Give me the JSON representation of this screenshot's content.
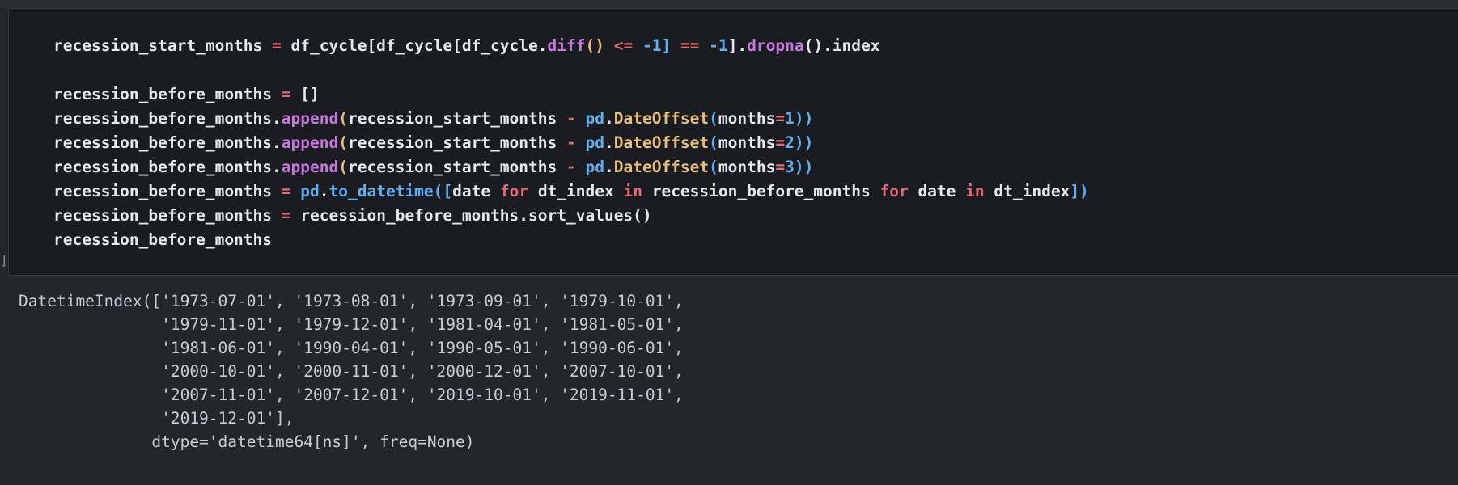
{
  "code_cell": {
    "marker": "]",
    "lines": [
      [
        {
          "t": "recession_start_months",
          "c": ""
        },
        {
          "t": " ",
          "c": ""
        },
        {
          "t": "=",
          "c": "tk-op"
        },
        {
          "t": " df_cycle[df_cycle[df_cycle.",
          "c": ""
        },
        {
          "t": "diff",
          "c": "tk-fn"
        },
        {
          "t": "()",
          "c": "tk-paren-y"
        },
        {
          "t": " ",
          "c": ""
        },
        {
          "t": "<=",
          "c": "tk-op"
        },
        {
          "t": " ",
          "c": ""
        },
        {
          "t": "-1",
          "c": "tk-num"
        },
        {
          "t": "]",
          "c": "tk-paren-b"
        },
        {
          "t": " ",
          "c": ""
        },
        {
          "t": "==",
          "c": "tk-op"
        },
        {
          "t": " ",
          "c": ""
        },
        {
          "t": "-1",
          "c": "tk-num"
        },
        {
          "t": "].",
          "c": ""
        },
        {
          "t": "dropna",
          "c": "tk-fn"
        },
        {
          "t": "().index",
          "c": ""
        }
      ],
      [],
      [
        {
          "t": "recession_before_months",
          "c": ""
        },
        {
          "t": " ",
          "c": ""
        },
        {
          "t": "=",
          "c": "tk-op"
        },
        {
          "t": " []",
          "c": ""
        }
      ],
      [
        {
          "t": "recession_before_months.",
          "c": ""
        },
        {
          "t": "append",
          "c": "tk-fn"
        },
        {
          "t": "(",
          "c": "tk-paren-y"
        },
        {
          "t": "recession_start_months ",
          "c": ""
        },
        {
          "t": "-",
          "c": "tk-op"
        },
        {
          "t": " ",
          "c": ""
        },
        {
          "t": "pd",
          "c": "tk-mod"
        },
        {
          "t": ".",
          "c": ""
        },
        {
          "t": "DateOffset",
          "c": "tk-cls"
        },
        {
          "t": "(",
          "c": "tk-paren-b"
        },
        {
          "t": "months",
          "c": ""
        },
        {
          "t": "=",
          "c": "tk-op"
        },
        {
          "t": "1",
          "c": "tk-num"
        },
        {
          "t": "))",
          "c": "tk-paren-b"
        }
      ],
      [
        {
          "t": "recession_before_months.",
          "c": ""
        },
        {
          "t": "append",
          "c": "tk-fn"
        },
        {
          "t": "(",
          "c": "tk-paren-y"
        },
        {
          "t": "recession_start_months ",
          "c": ""
        },
        {
          "t": "-",
          "c": "tk-op"
        },
        {
          "t": " ",
          "c": ""
        },
        {
          "t": "pd",
          "c": "tk-mod"
        },
        {
          "t": ".",
          "c": ""
        },
        {
          "t": "DateOffset",
          "c": "tk-cls"
        },
        {
          "t": "(",
          "c": "tk-paren-b"
        },
        {
          "t": "months",
          "c": ""
        },
        {
          "t": "=",
          "c": "tk-op"
        },
        {
          "t": "2",
          "c": "tk-num"
        },
        {
          "t": "))",
          "c": "tk-paren-b"
        }
      ],
      [
        {
          "t": "recession_before_months.",
          "c": ""
        },
        {
          "t": "append",
          "c": "tk-fn"
        },
        {
          "t": "(",
          "c": "tk-paren-y"
        },
        {
          "t": "recession_start_months ",
          "c": ""
        },
        {
          "t": "-",
          "c": "tk-op"
        },
        {
          "t": " ",
          "c": ""
        },
        {
          "t": "pd",
          "c": "tk-mod"
        },
        {
          "t": ".",
          "c": ""
        },
        {
          "t": "DateOffset",
          "c": "tk-cls"
        },
        {
          "t": "(",
          "c": "tk-paren-b"
        },
        {
          "t": "months",
          "c": ""
        },
        {
          "t": "=",
          "c": "tk-op"
        },
        {
          "t": "3",
          "c": "tk-num"
        },
        {
          "t": "))",
          "c": "tk-paren-b"
        }
      ],
      [
        {
          "t": "recession_before_months",
          "c": ""
        },
        {
          "t": " ",
          "c": ""
        },
        {
          "t": "=",
          "c": "tk-op"
        },
        {
          "t": " ",
          "c": ""
        },
        {
          "t": "pd",
          "c": "tk-mod"
        },
        {
          "t": ".",
          "c": ""
        },
        {
          "t": "to_datetime",
          "c": "tk-mod"
        },
        {
          "t": "([",
          "c": "tk-paren-b"
        },
        {
          "t": "date ",
          "c": ""
        },
        {
          "t": "for",
          "c": "tk-kw"
        },
        {
          "t": " dt_index ",
          "c": ""
        },
        {
          "t": "in",
          "c": "tk-kw"
        },
        {
          "t": " recession_before_months ",
          "c": ""
        },
        {
          "t": "for",
          "c": "tk-kw"
        },
        {
          "t": " date ",
          "c": ""
        },
        {
          "t": "in",
          "c": "tk-kw"
        },
        {
          "t": " dt_index",
          "c": ""
        },
        {
          "t": "])",
          "c": "tk-paren-b"
        }
      ],
      [
        {
          "t": "recession_before_months",
          "c": ""
        },
        {
          "t": " ",
          "c": ""
        },
        {
          "t": "=",
          "c": "tk-op"
        },
        {
          "t": " recession_before_months.sort_values()",
          "c": ""
        }
      ],
      [
        {
          "t": "recession_before_months",
          "c": ""
        }
      ]
    ]
  },
  "output": {
    "lines": [
      "DatetimeIndex(['1973-07-01', '1973-08-01', '1973-09-01', '1979-10-01',",
      "               '1979-11-01', '1979-12-01', '1981-04-01', '1981-05-01',",
      "               '1981-06-01', '1990-04-01', '1990-05-01', '1990-06-01',",
      "               '2000-10-01', '2000-11-01', '2000-12-01', '2007-10-01',",
      "               '2007-11-01', '2007-12-01', '2019-10-01', '2019-11-01',",
      "               '2019-12-01'],",
      "              dtype='datetime64[ns]', freq=None)"
    ]
  }
}
